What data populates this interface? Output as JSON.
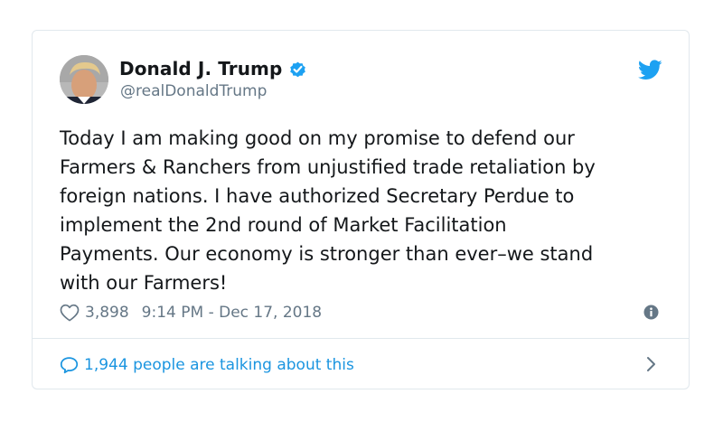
{
  "author": {
    "name": "Donald J. Trump",
    "handle": "@realDonaldTrump",
    "verified": true,
    "avatar_icon": "user-avatar-photo"
  },
  "tweet": {
    "lines": [
      "Today I am making good on my promise to defend our",
      "Farmers & Ranchers from unjustified trade retaliation by",
      "foreign nations. I have authorized Secretary Perdue to",
      "implement the 2nd round of Market Facilitation",
      "Payments. Our economy is stronger than ever–we stand",
      "with our Farmers!"
    ]
  },
  "meta": {
    "likes": "3,898",
    "timestamp": "9:14 PM - Dec 17, 2018"
  },
  "footer": {
    "talking": "1,944 people are talking about this"
  },
  "icons": {
    "brand": "twitter-bird-icon",
    "like": "heart-icon",
    "info": "info-icon",
    "reply": "speech-bubble-icon",
    "more": "chevron-right-icon"
  },
  "colors": {
    "brand_blue": "#1da1f2",
    "link_blue": "#1b95e0",
    "text": "#14171a",
    "secondary": "#657786",
    "border": "#e1e8ed"
  }
}
